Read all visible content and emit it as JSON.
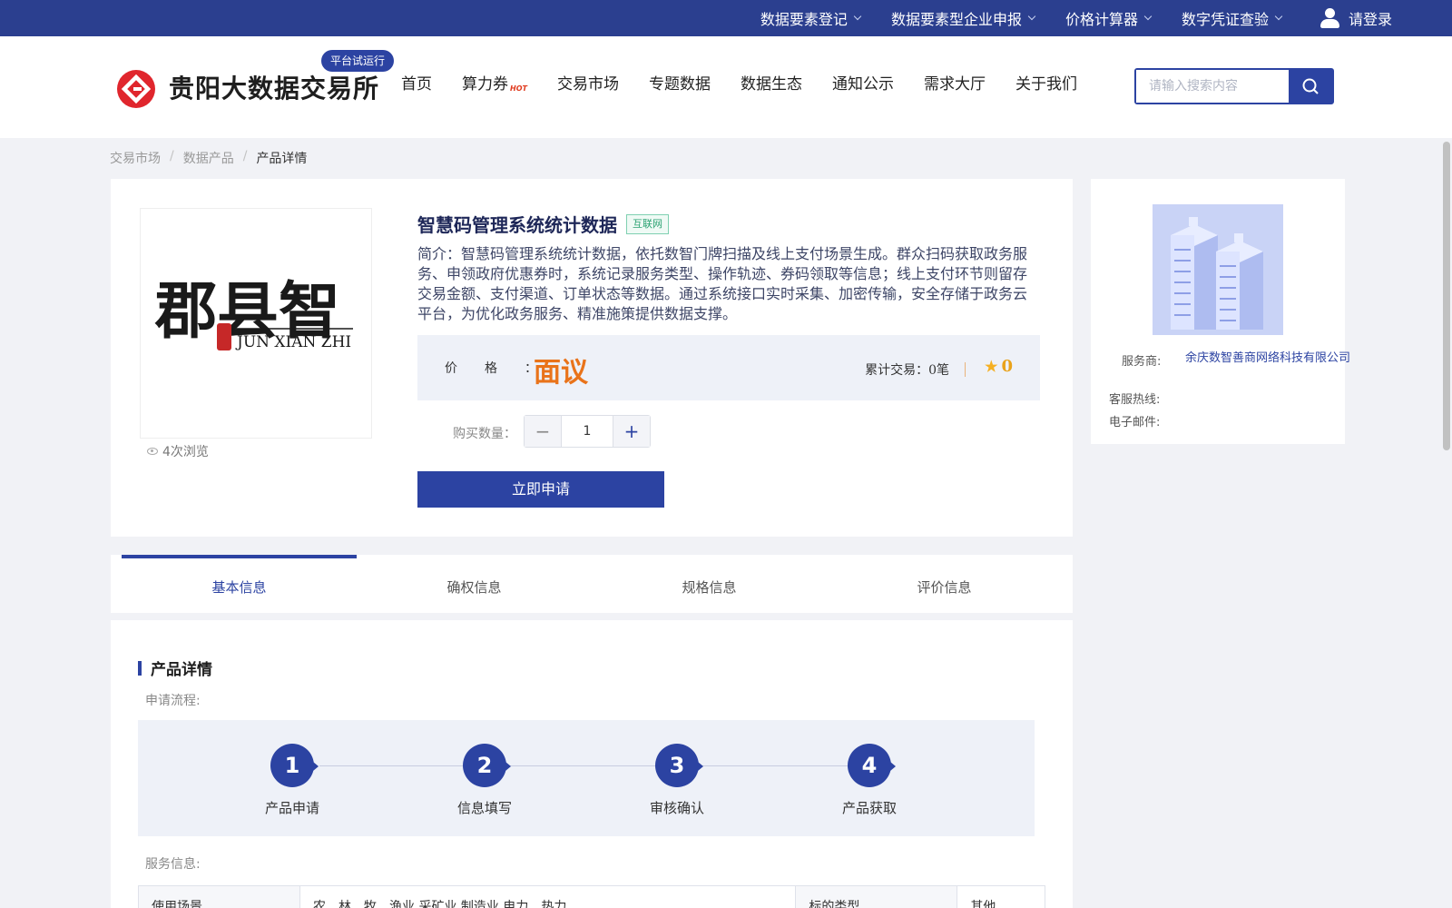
{
  "topbar": {
    "menu": [
      {
        "label": "数据要素登记"
      },
      {
        "label": "数据要素型企业申报"
      },
      {
        "label": "价格计算器"
      },
      {
        "label": "数字凭证查验"
      }
    ],
    "login_label": "请登录"
  },
  "header": {
    "site_name": "贵阳大数据交易所",
    "trial_badge": "平台试运行",
    "nav": [
      {
        "label": "首页"
      },
      {
        "label": "算力券",
        "badge": "HOT"
      },
      {
        "label": "交易市场"
      },
      {
        "label": "专题数据"
      },
      {
        "label": "数据生态"
      },
      {
        "label": "通知公示"
      },
      {
        "label": "需求大厅"
      },
      {
        "label": "关于我们"
      }
    ],
    "search_placeholder": "请输入搜索内容"
  },
  "breadcrumb": [
    "交易市场",
    "数据产品",
    "产品详情"
  ],
  "product": {
    "image_text_cn": "郡县智",
    "image_text_en": "JUN XIAN ZHI",
    "views": "4次浏览",
    "title": "智慧码管理系统统计数据",
    "tag": "互联网",
    "intro": "简介：智慧码管理系统统计数据，依托数智门牌扫描及线上支付场景生成。群众扫码获取政务服务、申领政府优惠券时，系统记录服务类型、操作轨迹、券码领取等信息；线上支付环节则留存交易金额、支付渠道、订单状态等数据。通过系统接口实时采集、加密传输，安全存储于政务云平台，为优化政务服务、精准施策提供数据支撑。",
    "price_label": "价格：",
    "price_value": "面议",
    "deals_label": "累计交易：",
    "deals_value": "0笔",
    "rating": "0",
    "qty_label": "购买数量：",
    "qty_value": "1",
    "apply_label": "立即申请"
  },
  "provider": {
    "service_label": "服务商:",
    "service_value": "余庆数智善商网络科技有限公司",
    "hotline_label": "客服热线:",
    "email_label": "电子邮件:"
  },
  "tabs": [
    {
      "label": "基本信息",
      "active": true
    },
    {
      "label": "确权信息"
    },
    {
      "label": "规格信息"
    },
    {
      "label": "评价信息"
    }
  ],
  "details": {
    "section_title": "产品详情",
    "process_label": "申请流程:",
    "steps": [
      {
        "num": "1",
        "name": "产品申请"
      },
      {
        "num": "2",
        "name": "信息填写"
      },
      {
        "num": "3",
        "name": "审核确认"
      },
      {
        "num": "4",
        "name": "产品获取"
      }
    ],
    "service_info_label": "服务信息:",
    "table": [
      {
        "k1": "使用场景",
        "v1": "农、林、牧、渔业,采矿业,制造业,电力、热力、",
        "k2": "标的类型",
        "v2": "其他"
      }
    ]
  },
  "colors": {
    "primary": "#2c43a2",
    "price": "#e9731a",
    "tag": "#2ba272"
  }
}
